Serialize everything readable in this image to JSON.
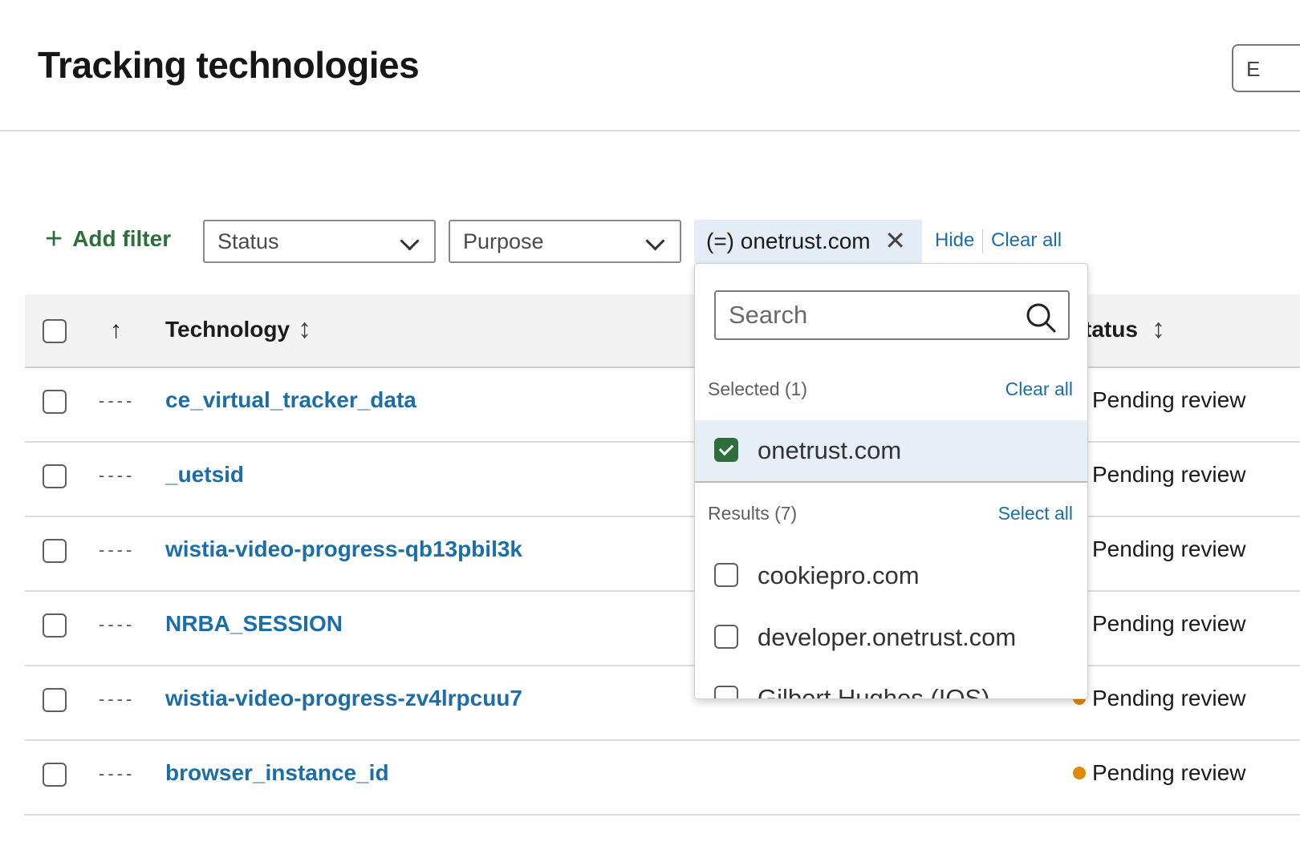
{
  "header": {
    "title": "Tracking technologies",
    "action_button_label": "E"
  },
  "filters": {
    "add_filter_label": "Add filter",
    "status_select_value": "Status",
    "purpose_select_value": "Purpose",
    "active_chip_label": "(=) onetrust.com",
    "hide_link": "Hide",
    "clear_all_link": "Clear all"
  },
  "table": {
    "columns": {
      "technology": "Technology",
      "status": "tatus"
    },
    "rows": [
      {
        "technology": "ce_virtual_tracker_data",
        "status": "Pending review"
      },
      {
        "technology": "_uetsid",
        "status": "Pending review"
      },
      {
        "technology": "wistia-video-progress-qb13pbil3k",
        "status": "Pending review"
      },
      {
        "technology": "NRBA_SESSION",
        "status": "Pending review"
      },
      {
        "technology": "wistia-video-progress-zv4lrpcuu7",
        "status": "Pending review"
      },
      {
        "technology": "browser_instance_id",
        "status": "Pending review"
      }
    ],
    "placeholder_dashes": "----"
  },
  "dropdown": {
    "search_placeholder": "Search",
    "selected_header": "Selected (1)",
    "selected_clear_all": "Clear all",
    "selected_items": [
      "onetrust.com"
    ],
    "results_header": "Results (7)",
    "results_select_all": "Select all",
    "results": [
      "cookiepro.com",
      "developer.onetrust.com",
      "Gilbert Hughes (IOS)"
    ]
  },
  "colors": {
    "link": "#1b6ea8",
    "accent_green": "#2e6e3a",
    "status_pending": "#e08a0c",
    "selected_bg": "#e6eef6"
  }
}
